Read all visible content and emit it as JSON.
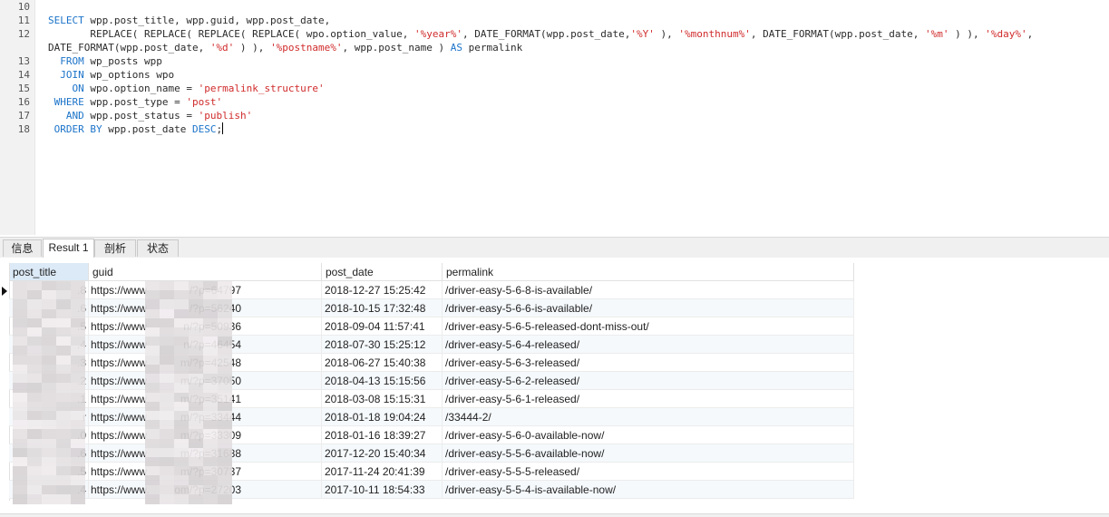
{
  "editor": {
    "lines": [
      {
        "n": "10",
        "tokens": []
      },
      {
        "n": "11",
        "tokens": [
          [
            "kw",
            "SELECT"
          ],
          [
            "p",
            " wpp.post_title, wpp.guid, wpp.post_date,"
          ]
        ]
      },
      {
        "n": "12",
        "tokens": [
          [
            "p",
            "       REPLACE( REPLACE( REPLACE( REPLACE( wpo.option_value, "
          ],
          [
            "str",
            "'%year%'"
          ],
          [
            "p",
            ", DATE_FORMAT(wpp.post_date,"
          ],
          [
            "str",
            "'%Y'"
          ],
          [
            "p",
            " ), "
          ],
          [
            "str",
            "'%monthnum%'"
          ],
          [
            "p",
            ", DATE_FORMAT(wpp.post_date, "
          ],
          [
            "str",
            "'%m'"
          ],
          [
            "p",
            " ) ), "
          ],
          [
            "str",
            "'%day%'"
          ],
          [
            "p",
            ","
          ]
        ]
      },
      {
        "n": "",
        "tokens": [
          [
            "p",
            "DATE_FORMAT(wpp.post_date, "
          ],
          [
            "str",
            "'%d'"
          ],
          [
            "p",
            " ) ), "
          ],
          [
            "str",
            "'%postname%'"
          ],
          [
            "p",
            ", wpp.post_name ) "
          ],
          [
            "kw",
            "AS"
          ],
          [
            "p",
            " permalink"
          ]
        ]
      },
      {
        "n": "13",
        "tokens": [
          [
            "p",
            "  "
          ],
          [
            "kw",
            "FROM"
          ],
          [
            "p",
            " wp_posts wpp"
          ]
        ]
      },
      {
        "n": "14",
        "tokens": [
          [
            "p",
            "  "
          ],
          [
            "kw",
            "JOIN"
          ],
          [
            "p",
            " wp_options wpo"
          ]
        ]
      },
      {
        "n": "15",
        "tokens": [
          [
            "p",
            "    "
          ],
          [
            "kw",
            "ON"
          ],
          [
            "p",
            " wpo.option_name = "
          ],
          [
            "str",
            "'permalink_structure'"
          ]
        ]
      },
      {
        "n": "16",
        "tokens": [
          [
            "p",
            " "
          ],
          [
            "kw",
            "WHERE"
          ],
          [
            "p",
            " wpp.post_type = "
          ],
          [
            "str",
            "'post'"
          ]
        ]
      },
      {
        "n": "17",
        "tokens": [
          [
            "p",
            "   "
          ],
          [
            "kw",
            "AND"
          ],
          [
            "p",
            " wpp.post_status = "
          ],
          [
            "str",
            "'publish'"
          ]
        ]
      },
      {
        "n": "18",
        "tokens": [
          [
            "p",
            " "
          ],
          [
            "kw",
            "ORDER BY"
          ],
          [
            "p",
            " wpp.post_date "
          ],
          [
            "kw",
            "DESC"
          ],
          [
            "p",
            ";"
          ]
        ],
        "caret": true
      }
    ]
  },
  "tabs": [
    {
      "label": "信息",
      "active": false
    },
    {
      "label": "Result 1",
      "active": true
    },
    {
      "label": "剖析",
      "active": false
    },
    {
      "label": "状态",
      "active": false
    }
  ],
  "grid": {
    "columns": [
      "post_title",
      "guid",
      "post_date",
      "permalink"
    ],
    "rows": [
      {
        "title": ".8",
        "guid": "https://www",
        "guid_tail": "/?p=64797",
        "date": "2018-12-27 15:25:42",
        "perm": "/driver-easy-5-6-8-is-available/"
      },
      {
        "title": ".6",
        "guid": "https://www",
        "guid_tail": "/?p=56240",
        "date": "2018-10-15 17:32:48",
        "perm": "/driver-easy-5-6-6-is-available/"
      },
      {
        "title": ".5",
        "guid": "https://www",
        "guid_tail": "n/?p=50936",
        "date": "2018-09-04 11:57:41",
        "perm": "/driver-easy-5-6-5-released-dont-miss-out/"
      },
      {
        "title": ".4",
        "guid": "https://www",
        "guid_tail": "n/?p=46454",
        "date": "2018-07-30 15:25:12",
        "perm": "/driver-easy-5-6-4-released/"
      },
      {
        "title": ".3",
        "guid": "https://www",
        "guid_tail": "m/?p=42548",
        "date": "2018-06-27 15:40:38",
        "perm": "/driver-easy-5-6-3-released/"
      },
      {
        "title": ".2",
        "guid": "https://www",
        "guid_tail": "m/?p=37050",
        "date": "2018-04-13 15:15:56",
        "perm": "/driver-easy-5-6-2-released/"
      },
      {
        "title": ".1",
        "guid": "https://www",
        "guid_tail": "m/?p=35141",
        "date": "2018-03-08 15:15:31",
        "perm": "/driver-easy-5-6-1-released/"
      },
      {
        "title": "r",
        "guid": "https://www",
        "guid_tail": "m/?p=33444",
        "date": "2018-01-18 19:04:24",
        "perm": "/33444-2/"
      },
      {
        "title": ".0",
        "guid": "https://www",
        "guid_tail": "m/?p=33309",
        "date": "2018-01-16 18:39:27",
        "perm": "/driver-easy-5-6-0-available-now/"
      },
      {
        "title": ".6",
        "guid": "https://www",
        "guid_tail": "m/?p=31688",
        "date": "2017-12-20 15:40:34",
        "perm": "/driver-easy-5-5-6-available-now/"
      },
      {
        "title": ".5",
        "guid": "https://www",
        "guid_tail": "m/?p=30737",
        "date": "2017-11-24 20:41:39",
        "perm": "/driver-easy-5-5-5-released/"
      },
      {
        "title": ".4",
        "guid": "https://www.",
        "guid_tail": "om/?p=27203",
        "date": "2017-10-11 18:54:33",
        "perm": "/driver-easy-5-5-4-is-available-now/"
      }
    ]
  }
}
